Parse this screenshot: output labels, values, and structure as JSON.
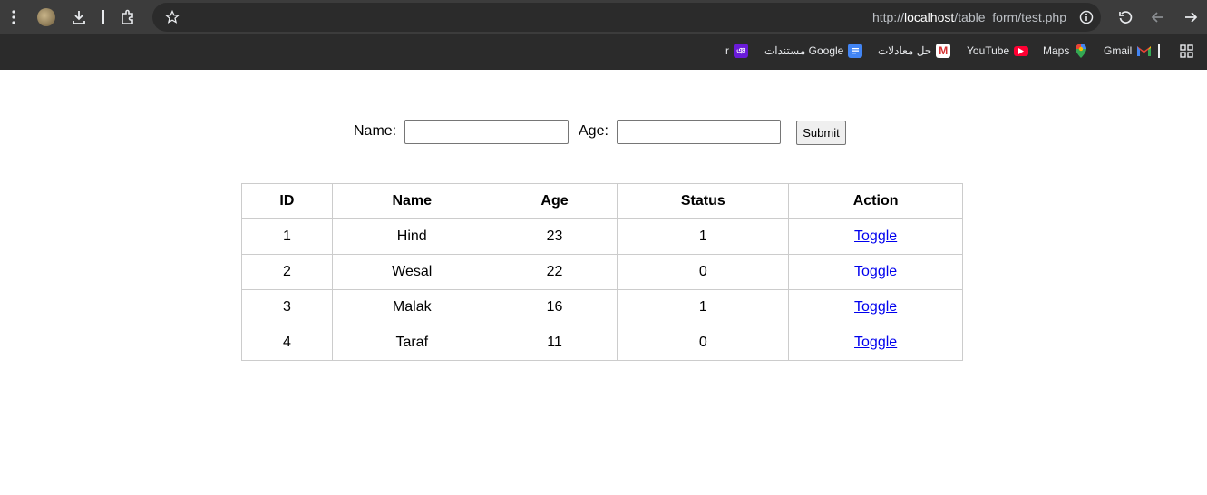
{
  "browser": {
    "url_prefix": "http://",
    "url_host": "localhost",
    "url_path": "/table_form/test.php",
    "bookmarks": [
      {
        "label": "Gmail",
        "icon": "gmail-icon"
      },
      {
        "label": "Maps",
        "icon": "maps-icon"
      },
      {
        "label": "YouTube",
        "icon": "youtube-icon"
      },
      {
        "label": "حل معادلات",
        "icon": "math-icon"
      },
      {
        "label": "مستندات Google",
        "icon": "google-docs-icon"
      },
      {
        "label": "r",
        "icon": "bookmark-icon"
      }
    ]
  },
  "form": {
    "name_label": "Name:",
    "name_value": "",
    "age_label": "Age:",
    "age_value": "",
    "submit_label": "Submit"
  },
  "table": {
    "headers": [
      "ID",
      "Name",
      "Age",
      "Status",
      "Action"
    ],
    "rows": [
      {
        "id": "1",
        "name": "Hind",
        "age": "23",
        "status": "1",
        "action": "Toggle"
      },
      {
        "id": "2",
        "name": "Wesal",
        "age": "22",
        "status": "0",
        "action": "Toggle"
      },
      {
        "id": "3",
        "name": "Malak",
        "age": "16",
        "status": "1",
        "action": "Toggle"
      },
      {
        "id": "4",
        "name": "Taraf",
        "age": "11",
        "status": "0",
        "action": "Toggle"
      }
    ]
  },
  "colors": {
    "toolbar_bg": "#3c3c3c",
    "bookmarks_bg": "#2b2b2b",
    "link": "#0000ee",
    "table_border": "#cccccc"
  }
}
